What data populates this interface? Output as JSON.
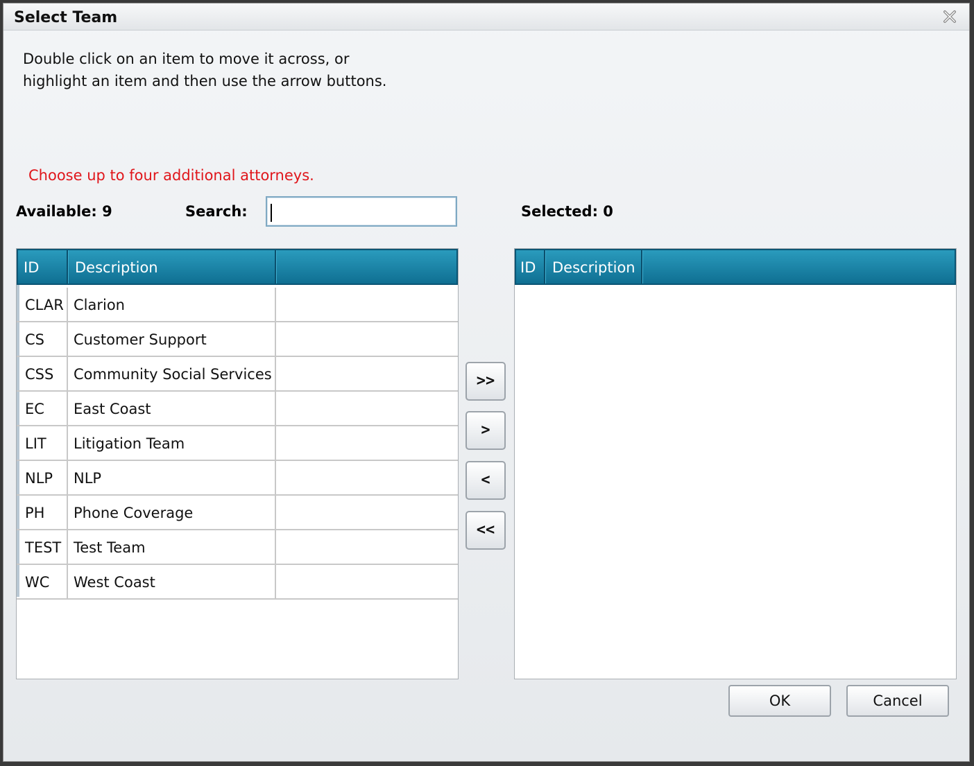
{
  "dialog": {
    "title": "Select Team",
    "instructions": [
      "Double click on an item to move it across, or",
      "highlight an item and then use the arrow buttons."
    ],
    "notice": "Choose up to four additional attorneys.",
    "notice_color": "#e0161b",
    "close_icon": "close-icon"
  },
  "available": {
    "label": "Available: 9",
    "search_label": "Search:",
    "search_value": "",
    "columns": [
      "ID",
      "Description",
      ""
    ],
    "rows": [
      {
        "id": "CLAR",
        "description": "Clarion"
      },
      {
        "id": "CS",
        "description": "Customer Support"
      },
      {
        "id": "CSS",
        "description": "Community Social Services"
      },
      {
        "id": "EC",
        "description": "East Coast"
      },
      {
        "id": "LIT",
        "description": "Litigation Team"
      },
      {
        "id": "NLP",
        "description": "NLP"
      },
      {
        "id": "PH",
        "description": "Phone Coverage"
      },
      {
        "id": "TEST",
        "description": "Test Team"
      },
      {
        "id": "WC",
        "description": "West Coast"
      }
    ]
  },
  "selected": {
    "label": "Selected: 0",
    "columns": [
      "ID",
      "Description"
    ],
    "rows": []
  },
  "transfer_buttons": {
    "add_all": ">>",
    "add": ">",
    "remove": "<",
    "remove_all": "<<"
  },
  "actions": {
    "ok": "OK",
    "cancel": "Cancel"
  },
  "colors": {
    "header_top": "#2a9bbd",
    "header_bottom": "#0f6f92"
  }
}
